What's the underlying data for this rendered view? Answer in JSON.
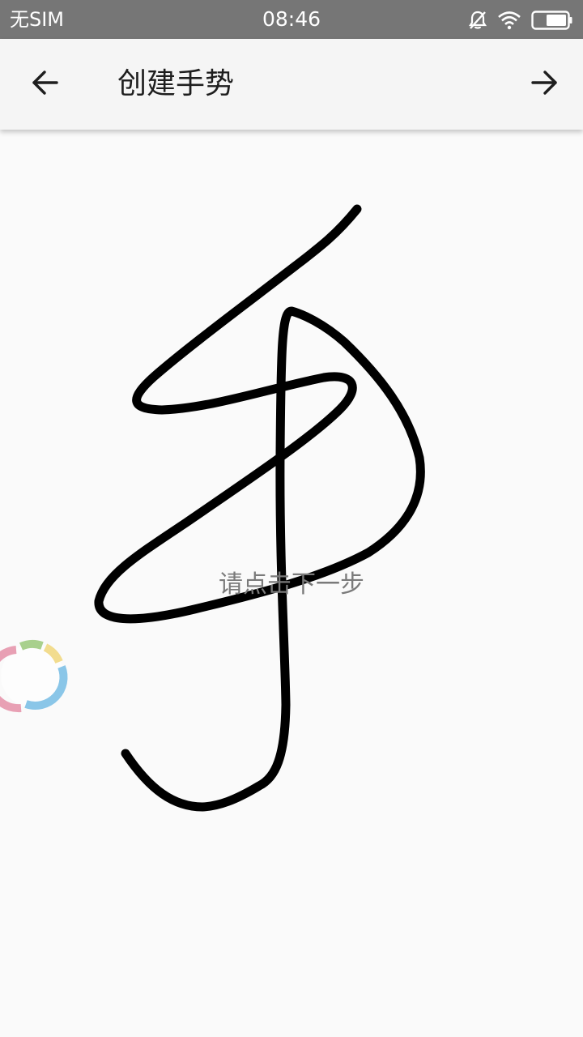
{
  "status_bar": {
    "carrier": "无SIM",
    "time": "08:46",
    "icons": [
      "bell-off-icon",
      "wifi-icon",
      "battery-icon"
    ],
    "color": "#767676"
  },
  "app_bar": {
    "title": "创建手势",
    "back_icon": "arrow-left-icon",
    "next_icon": "arrow-right-icon",
    "background": "#f5f5f5"
  },
  "canvas": {
    "hint": "请点击下一步",
    "stroke_color": "#000000",
    "background": "#fafafa"
  },
  "floating_widget": {
    "icon": "assistive-ring-icon",
    "colors": [
      "#e8a0b4",
      "#a8d08d",
      "#f2dc8e",
      "#8ac6e8"
    ]
  }
}
